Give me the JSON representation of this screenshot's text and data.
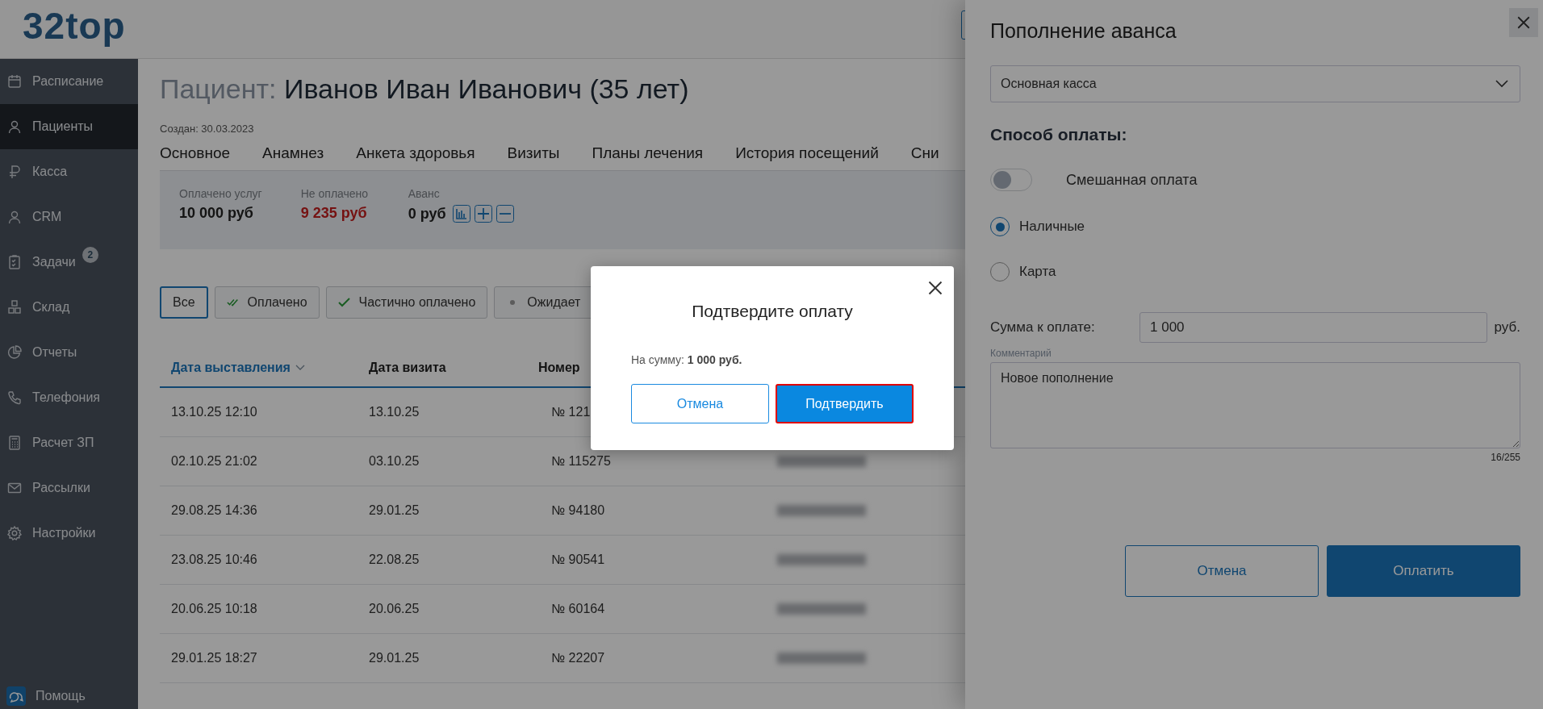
{
  "logo": "32top",
  "sidebar": {
    "items": [
      {
        "label": "Расписание",
        "selected": false
      },
      {
        "label": "Пациенты",
        "selected": true
      },
      {
        "label": "Касса",
        "selected": false
      },
      {
        "label": "CRM",
        "selected": false
      },
      {
        "label": "Задачи",
        "selected": false,
        "badge": "2"
      },
      {
        "label": "Склад",
        "selected": false
      },
      {
        "label": "Отчеты",
        "selected": false
      },
      {
        "label": "Телефония",
        "selected": false
      },
      {
        "label": "Расчет ЗП",
        "selected": false
      },
      {
        "label": "Рассылки",
        "selected": false
      },
      {
        "label": "Настройки",
        "selected": false
      }
    ],
    "help": "Помощь"
  },
  "patient": {
    "label": "Пациент:",
    "name": "Иванов Иван Иванович (35 лет)",
    "created": "Создан: 30.03.2023"
  },
  "tabs": [
    "Основное",
    "Анамнез",
    "Анкета здоровья",
    "Визиты",
    "Планы лечения",
    "История посещений",
    "Сни"
  ],
  "summary": [
    {
      "label": "Оплачено услуг",
      "value": "10 000 руб",
      "kind": "normal"
    },
    {
      "label": "Не оплачено",
      "value": "9 235 руб",
      "kind": "debt"
    },
    {
      "label": "Аванс",
      "value": "0 руб",
      "kind": "advance"
    }
  ],
  "filters": [
    {
      "label": "Все",
      "selected": true,
      "kind": "plain"
    },
    {
      "label": "Оплачено",
      "selected": false,
      "kind": "double-check"
    },
    {
      "label": "Частично оплачено",
      "selected": false,
      "kind": "check"
    },
    {
      "label": "Ожидает",
      "selected": false,
      "kind": "dot"
    }
  ],
  "table": {
    "columns": [
      {
        "label": "Дата выставления",
        "sorted": true
      },
      {
        "label": "Дата визита",
        "sorted": false
      },
      {
        "label": "Номер",
        "sorted": false
      }
    ],
    "rows": [
      {
        "issued": "13.10.25 12:10",
        "visit": "13.10.25",
        "number": "№ 121"
      },
      {
        "issued": "02.10.25 21:02",
        "visit": "03.10.25",
        "number": "№ 115275",
        "blurred": true
      },
      {
        "issued": "29.08.25 14:36",
        "visit": "29.01.25",
        "number": "№ 94180",
        "blurred": true
      },
      {
        "issued": "23.08.25 10:46",
        "visit": "22.08.25",
        "number": "№ 90541",
        "blurred": true
      },
      {
        "issued": "20.06.25 10:18",
        "visit": "20.06.25",
        "number": "№ 60164",
        "blurred": true
      },
      {
        "issued": "29.01.25 18:27",
        "visit": "29.01.25",
        "number": "№ 22207",
        "blurred": true
      }
    ]
  },
  "panel": {
    "title": "Пополнение аванса",
    "register": "Основная касса",
    "method_heading": "Способ оплаты:",
    "mixed": {
      "label": "Смешанная оплата",
      "on": false
    },
    "methods": [
      {
        "label": "Наличные",
        "selected": true
      },
      {
        "label": "Карта",
        "selected": false
      }
    ],
    "amount": {
      "label": "Сумма к оплате:",
      "value": "1 000",
      "unit": "руб."
    },
    "comment": {
      "label": "Комментарий",
      "value": "Новое пополнение",
      "counter": "16/255"
    },
    "buttons": [
      {
        "label": "Отмена",
        "kind": "secondary"
      },
      {
        "label": "Оплатить",
        "kind": "primary"
      }
    ]
  },
  "modal": {
    "title": "Подтвердите оплату",
    "text": "На сумму: **1 000 руб.**",
    "buttons": [
      {
        "label": "Отмена",
        "kind": "secondary",
        "focused": false
      },
      {
        "label": "Подтвердить",
        "kind": "primary",
        "focused": true
      }
    ]
  }
}
